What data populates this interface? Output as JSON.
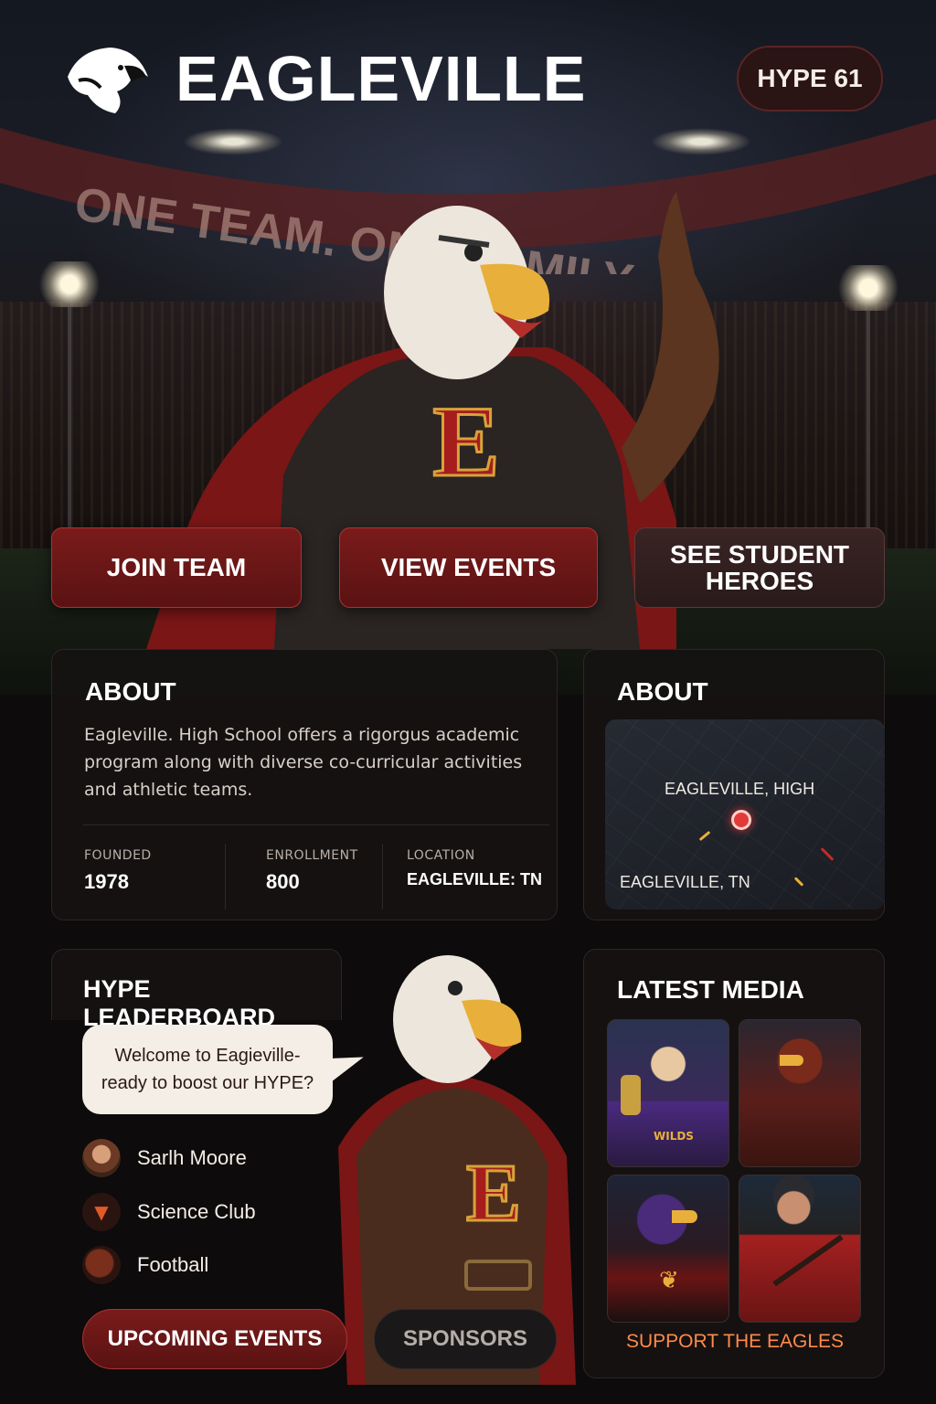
{
  "header": {
    "app_title": "EAGLEVILLE",
    "hype_badge": "HYPE 61"
  },
  "hero": {
    "banner_text": "ONE TEAM. ONE FAMILY.",
    "mascot_letter": "E"
  },
  "actions": {
    "join_team": "JOIN TEAM",
    "view_events": "VIEW EVENTS",
    "student_heroes_line1": "SEE STUDENT",
    "student_heroes_line2": "HEROES"
  },
  "about": {
    "title": "ABOUT",
    "description": "Eagleville. High School offers a rigorgus academic program along with diverse co-curricular activities and athletic teams.",
    "stats": [
      {
        "label": "FOUNDED",
        "value": "1978"
      },
      {
        "label": "ENROLLMENT",
        "value": "800"
      },
      {
        "label": "LOCATION",
        "value": "EAGLEVILLE: TN"
      }
    ]
  },
  "about_map": {
    "title": "ABOUT",
    "school_label": "EAGLEVILLE, HIGH",
    "town_label": "EAGLEVILLE, TN"
  },
  "leaderboard": {
    "title": "HYPE LEADERBOARD",
    "bubble_line1": "Welcome to Eagieville-",
    "bubble_line2": "ready to boost our HYPE?",
    "entries": [
      {
        "name": "Sarlh Moore",
        "icon": "person-avatar-icon"
      },
      {
        "name": "Science Club",
        "icon": "eagle-badge-icon"
      },
      {
        "name": "Football",
        "icon": "football-icon"
      }
    ]
  },
  "bottom_buttons": {
    "upcoming_events": "UPCOMING EVENTS",
    "sponsors": "SPONSORS"
  },
  "media": {
    "title": "LATEST MEDIA",
    "tiles": [
      {
        "icon": "student-trophy-photo-icon",
        "shirt_text": "WILDS"
      },
      {
        "icon": "red-mascot-photo-icon"
      },
      {
        "icon": "purple-eagle-photo-icon"
      },
      {
        "icon": "baseball-player-photo-icon"
      }
    ],
    "support_link": "SUPPORT THE EAGLES"
  },
  "colors": {
    "accent_red": "#7a1b1b",
    "link_orange": "#ff8a4a",
    "pin_red": "#e23a3a"
  }
}
